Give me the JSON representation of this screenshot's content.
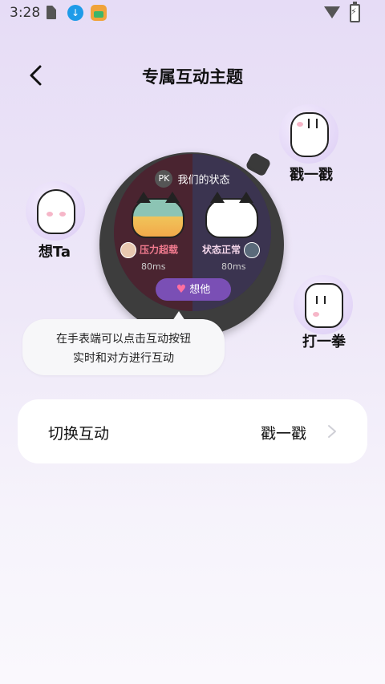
{
  "status_bar": {
    "time": "3:28"
  },
  "header": {
    "title": "专属互动主题"
  },
  "actions": {
    "poke": "戳一戳",
    "miss_you": "想Ta",
    "punch": "打一拳"
  },
  "watch": {
    "pk_badge": "PK",
    "title": "我们的状态",
    "left_status": "压力超载",
    "left_latency": "80ms",
    "right_status": "状态正常",
    "right_latency": "80ms",
    "button_label": "想他"
  },
  "tooltip": {
    "line1": "在手表端可以点击互动按钮",
    "line2": "实时和对方进行互动"
  },
  "switch_card": {
    "label": "切换互动",
    "value": "戳一戳"
  }
}
